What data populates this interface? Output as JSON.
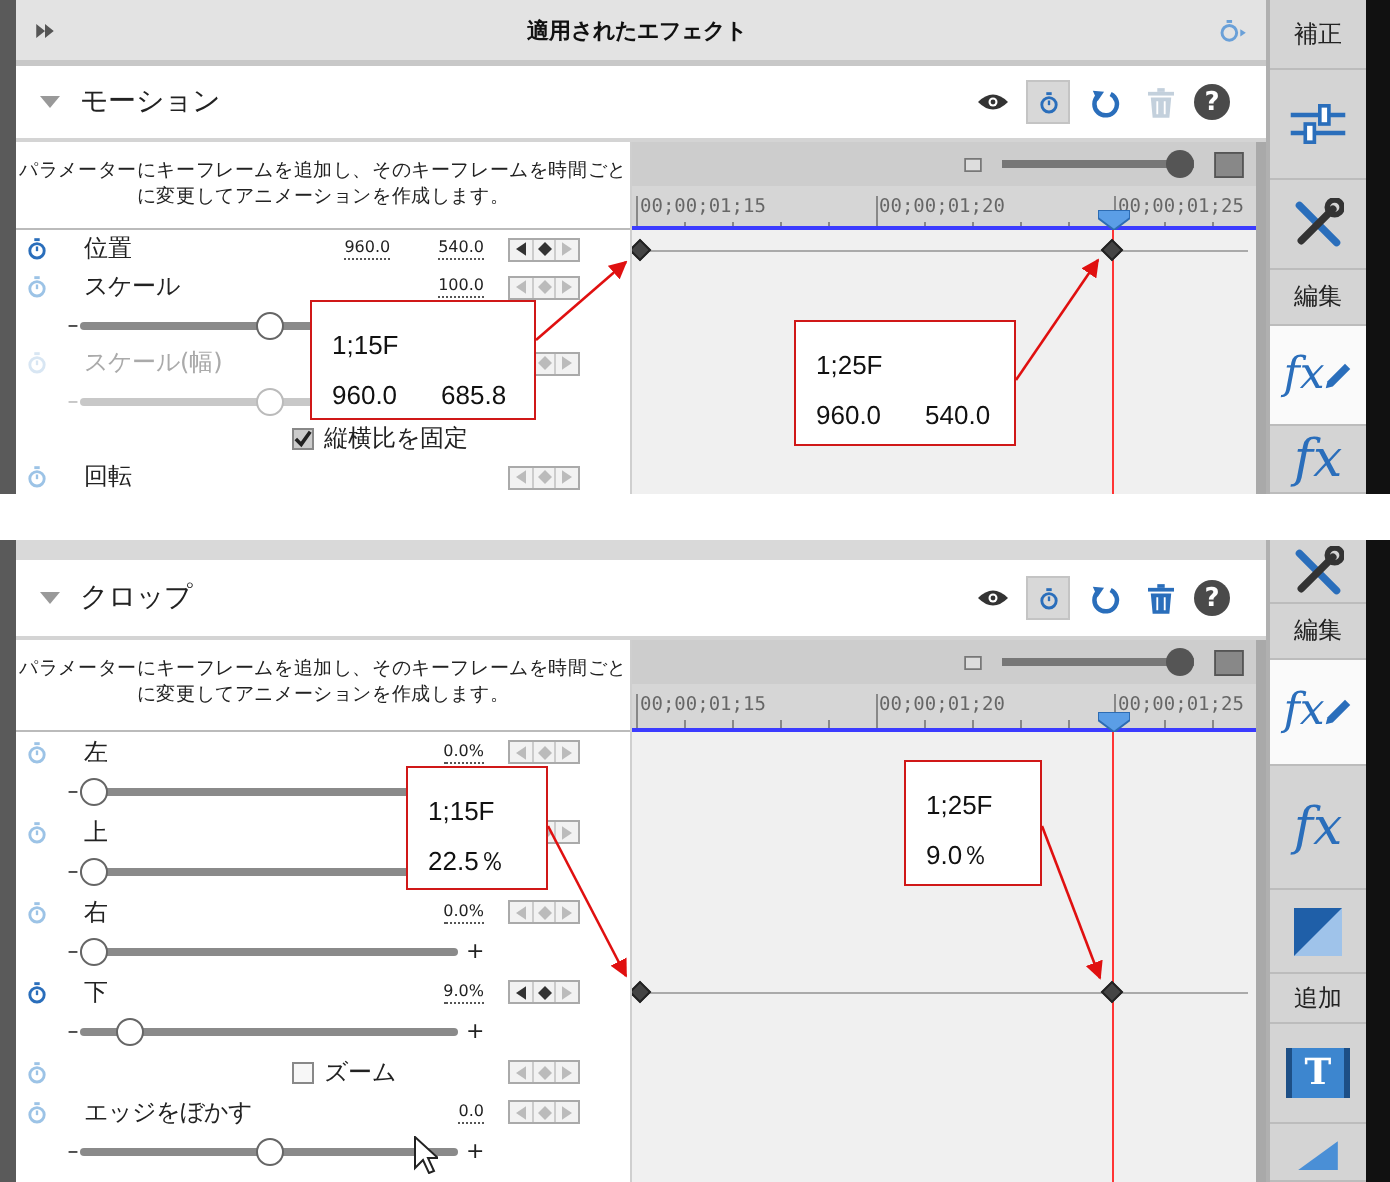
{
  "panels": [
    {
      "header": {
        "title": "適用されたエフェクト"
      },
      "section": {
        "title": "モーション",
        "expanded": true,
        "tools": [
          {
            "kind": "eye",
            "selected": false
          },
          {
            "kind": "stopwatch",
            "selected": true
          },
          {
            "kind": "reset",
            "selected": false
          },
          {
            "kind": "trash",
            "selected": false,
            "disabled": true
          },
          {
            "kind": "help",
            "glyph": "?",
            "selected": false
          }
        ],
        "description": [
          "パラメーターにキーフレームを追加し、そのキーフレームを時間ごと",
          "に変更してアニメーションを作成します。"
        ],
        "zoom": {
          "level": 1
        },
        "ruler": [
          "00;00;01;15",
          "00;00;01;20",
          "00;00;01;25"
        ],
        "playhead": {
          "level": 0.755
        },
        "rows": [
          {
            "kind": "param",
            "label": "位置",
            "values": [
              "960.0",
              "540.0"
            ],
            "animated": true,
            "disabled": false,
            "keyframes": [
              {
                "level": 0
              },
              {
                "level": 0.755
              }
            ]
          },
          {
            "kind": "param",
            "label": "スケール",
            "values": [
              "100.0"
            ],
            "animated": false,
            "disabled": false
          },
          {
            "kind": "slider",
            "minus": "–",
            "level": 0.5,
            "disabled": false
          },
          {
            "kind": "param",
            "label": "スケール(幅)",
            "animated": false,
            "disabled": true
          },
          {
            "kind": "slider",
            "minus": "–",
            "level": 0.5,
            "disabled": true
          },
          {
            "kind": "checkbox",
            "label": "縦横比を固定",
            "checked": true
          },
          {
            "kind": "param",
            "label": "回転",
            "animated": false,
            "disabled": false
          }
        ]
      },
      "callouts": [
        {
          "lines": [
            [
              "1;15F"
            ],
            [
              "960.0",
              "685.8"
            ]
          ]
        },
        {
          "lines": [
            [
              "1;25F"
            ],
            [
              "960.0",
              "540.0"
            ]
          ]
        }
      ],
      "sidebar": [
        {
          "kind": "label",
          "text": "補正",
          "selected": false
        },
        {
          "kind": "sliders",
          "selected": false
        },
        {
          "kind": "tools",
          "selected": false
        },
        {
          "kind": "label",
          "text": "編集",
          "selected": false
        },
        {
          "kind": "fx-edit",
          "glyph": "fx",
          "selected": true
        },
        {
          "kind": "fx",
          "glyph": "fx",
          "selected": false
        }
      ]
    },
    {
      "section": {
        "title": "クロップ",
        "expanded": true,
        "tools": [
          {
            "kind": "eye",
            "selected": false
          },
          {
            "kind": "stopwatch",
            "selected": true
          },
          {
            "kind": "reset",
            "selected": false
          },
          {
            "kind": "trash",
            "selected": false,
            "disabled": false
          },
          {
            "kind": "help",
            "glyph": "?",
            "selected": false
          }
        ],
        "description": [
          "パラメーターにキーフレームを追加し、そのキーフレームを時間ごと",
          "に変更してアニメーションを作成します。"
        ],
        "zoom": {
          "level": 1
        },
        "ruler": [
          "00;00;01;15",
          "00;00;01;20",
          "00;00;01;25"
        ],
        "playhead": {
          "level": 0.755
        },
        "rows": [
          {
            "kind": "param",
            "label": "左",
            "values": [
              "0.0%"
            ],
            "animated": false,
            "disabled": false
          },
          {
            "kind": "slider",
            "minus": "–",
            "level": 0,
            "disabled": false
          },
          {
            "kind": "param",
            "label": "上",
            "animated": false,
            "disabled": false
          },
          {
            "kind": "slider",
            "minus": "–",
            "level": 0,
            "disabled": false
          },
          {
            "kind": "param",
            "label": "右",
            "values": [
              "0.0%"
            ],
            "animated": false,
            "disabled": false
          },
          {
            "kind": "slider",
            "minus": "–",
            "plus": "+",
            "level": 0,
            "disabled": false
          },
          {
            "kind": "param",
            "label": "下",
            "values": [
              "9.0%"
            ],
            "animated": true,
            "disabled": false,
            "keyframes": [
              {
                "level": 0
              },
              {
                "level": 0.755
              }
            ]
          },
          {
            "kind": "slider",
            "minus": "–",
            "plus": "+",
            "level": 0.1,
            "disabled": false
          },
          {
            "kind": "checkbox",
            "label": "ズーム",
            "checked": false,
            "animatable": true
          },
          {
            "kind": "param",
            "label": "エッジをぼかす",
            "values": [
              "0.0"
            ],
            "animated": false,
            "disabled": false
          },
          {
            "kind": "slider",
            "minus": "–",
            "plus": "+",
            "level": 0.5,
            "disabled": false
          }
        ]
      },
      "callouts": [
        {
          "lines": [
            [
              "1;15F"
            ],
            [
              "22.5％"
            ]
          ]
        },
        {
          "lines": [
            [
              "1;25F"
            ],
            [
              "9.0％"
            ]
          ]
        }
      ],
      "sidebar": [
        {
          "kind": "tools",
          "selected": false
        },
        {
          "kind": "label",
          "text": "編集",
          "selected": false
        },
        {
          "kind": "fx-edit",
          "glyph": "fx",
          "selected": true
        },
        {
          "kind": "fx",
          "glyph": "fx",
          "selected": false
        },
        {
          "kind": "gradient",
          "selected": false
        },
        {
          "kind": "label",
          "text": "追加",
          "selected": false
        },
        {
          "kind": "text-tool",
          "glyph": "T",
          "selected": false
        },
        {
          "kind": "shape",
          "selected": false
        }
      ]
    }
  ]
}
